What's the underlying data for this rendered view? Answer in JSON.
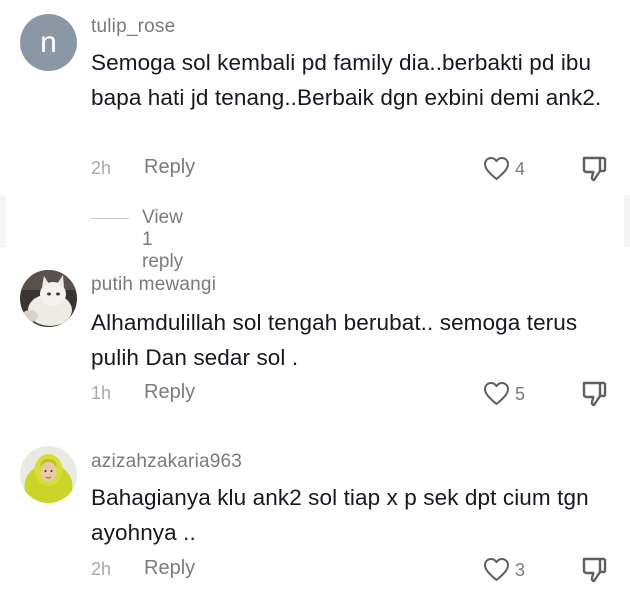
{
  "comments": [
    {
      "username": "tulip_rose",
      "avatar_letter": "n",
      "text": "Semoga sol kembali pd family dia..berbakti pd ibu bapa hati jd tenang..Berbaik dgn exbini demi ank2.",
      "time": "2h",
      "reply_label": "Reply",
      "likes": "4",
      "view_replies": "View 1 reply"
    },
    {
      "username": "putih mewangi",
      "text": "Alhamdulillah sol tengah berubat.. semoga terus pulih Dan sedar sol .",
      "time": "1h",
      "reply_label": "Reply",
      "likes": "5"
    },
    {
      "username": "azizahzakaria963",
      "text": "Bahagianya klu ank2 sol tiap x p sek dpt cium tgn ayohnya ..",
      "time": "2h",
      "reply_label": "Reply",
      "likes": "3"
    }
  ],
  "icons": {
    "like": "heart-outline-icon",
    "dislike": "thumbs-down-icon"
  },
  "colors": {
    "text": "#161823",
    "secondary": "#7b7b7e",
    "avatar_bg": "#8a98a6"
  }
}
